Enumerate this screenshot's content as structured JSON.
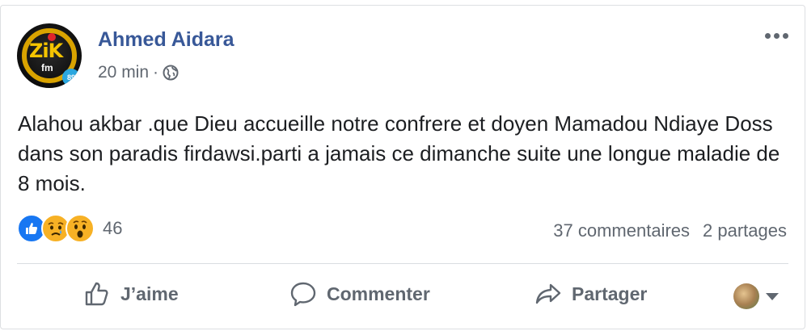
{
  "post": {
    "author": "Ahmed Aidara",
    "time": "20 min",
    "separator": "·",
    "audience_icon": "globe-icon",
    "avatar_text": {
      "zik": "ZiK",
      "fm": "fm",
      "badge": "89"
    },
    "text": "Alahou akbar .que Dieu accueille notre confrere et doyen Mamadou Ndiaye Doss dans son paradis firdawsi.parti a jamais ce dimanche suite une longue maladie de 8 mois.",
    "reactions": {
      "icons": [
        "like-reaction-icon",
        "sad-reaction-icon",
        "wow-reaction-icon"
      ],
      "count": "46"
    },
    "comments": "37 commentaires",
    "shares": "2 partages"
  },
  "actions": {
    "like": "J’aime",
    "comment": "Commenter",
    "share": "Partager"
  },
  "colors": {
    "link": "#385898",
    "secondary_text": "#606770",
    "like_blue": "#1877f2",
    "emoji_yellow": "#f7b125"
  }
}
